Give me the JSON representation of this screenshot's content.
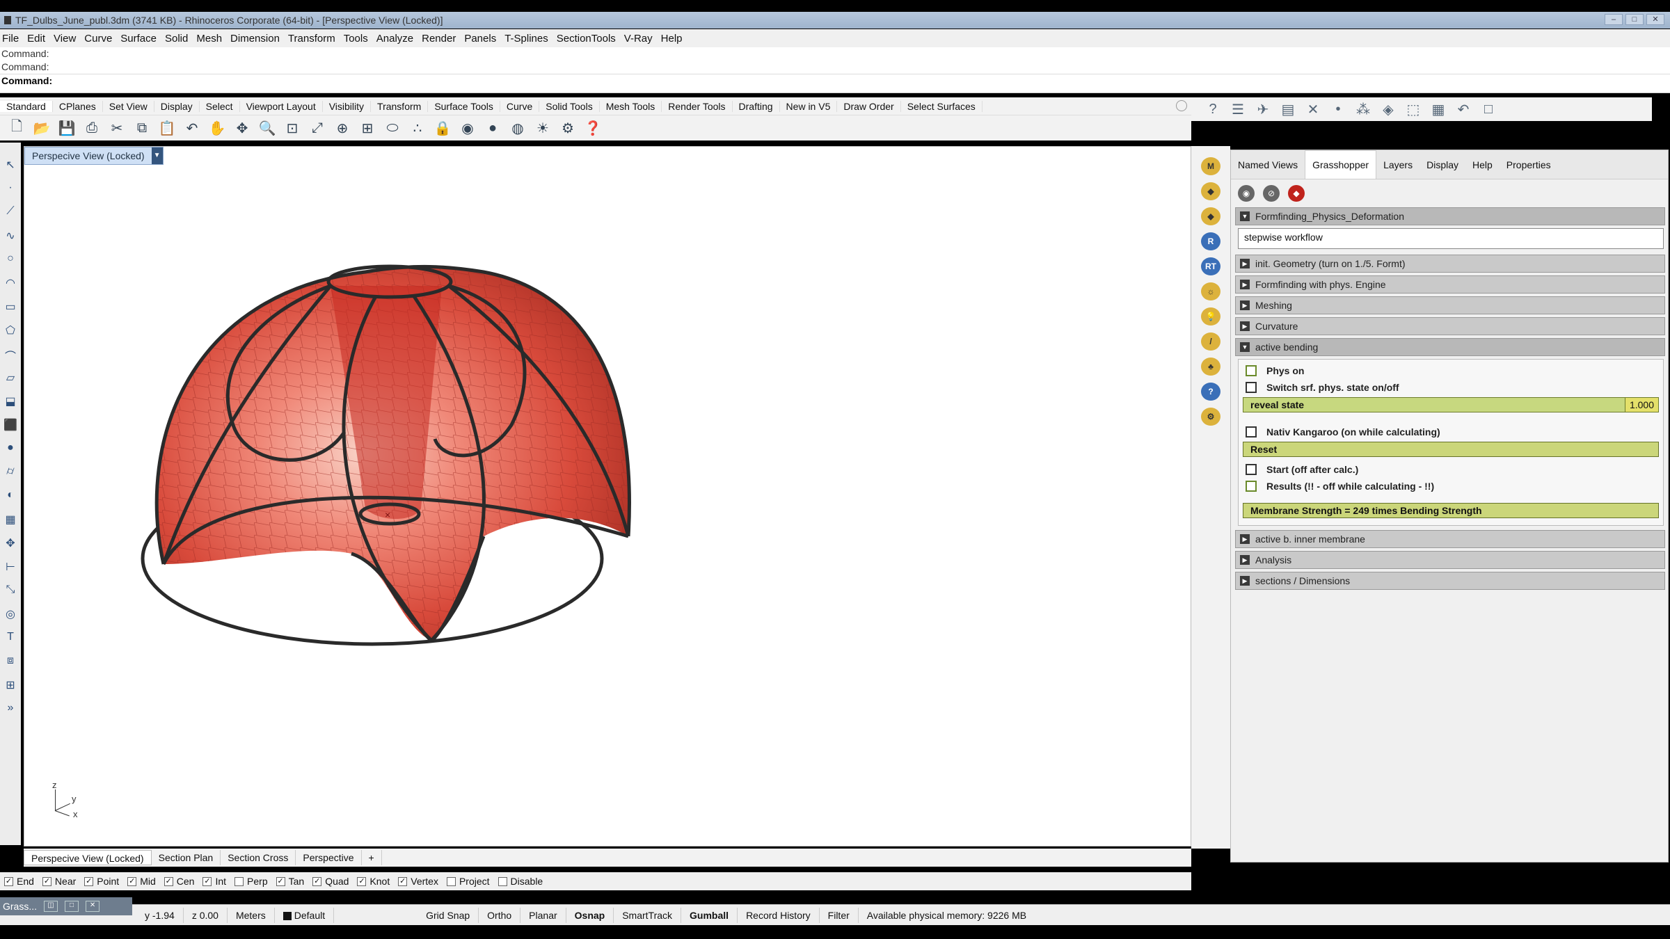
{
  "window": {
    "title": "TF_Dulbs_June_publ.3dm (3741 KB) - Rhinoceros Corporate (64-bit) - [Perspective View (Locked)]"
  },
  "menu": [
    "File",
    "Edit",
    "View",
    "Curve",
    "Surface",
    "Solid",
    "Mesh",
    "Dimension",
    "Transform",
    "Tools",
    "Analyze",
    "Render",
    "Panels",
    "T-Splines",
    "SectionTools",
    "V-Ray",
    "Help"
  ],
  "command": {
    "lines": [
      "Command:",
      "Command:"
    ],
    "active": "Command:"
  },
  "toolbar_tabs": [
    "Standard",
    "CPlanes",
    "Set View",
    "Display",
    "Select",
    "Viewport Layout",
    "Visibility",
    "Transform",
    "Surface Tools",
    "Curve",
    "Solid Tools",
    "Mesh Tools",
    "Render Tools",
    "Drafting",
    "New in V5",
    "Draw Order",
    "Select Surfaces"
  ],
  "viewport": {
    "title": "Perspecive View (Locked)",
    "axes": {
      "z": "z",
      "y": "y",
      "x": "x"
    }
  },
  "viewport_tabs": [
    "Perspecive View (Locked)",
    "Section Plan",
    "Section Cross",
    "Perspective",
    "+"
  ],
  "osnap": [
    {
      "label": "End",
      "checked": true
    },
    {
      "label": "Near",
      "checked": true
    },
    {
      "label": "Point",
      "checked": true
    },
    {
      "label": "Mid",
      "checked": true
    },
    {
      "label": "Cen",
      "checked": true
    },
    {
      "label": "Int",
      "checked": true
    },
    {
      "label": "Perp",
      "checked": false
    },
    {
      "label": "Tan",
      "checked": true
    },
    {
      "label": "Quad",
      "checked": true
    },
    {
      "label": "Knot",
      "checked": true
    },
    {
      "label": "Vertex",
      "checked": true
    },
    {
      "label": "Project",
      "checked": false
    },
    {
      "label": "Disable",
      "checked": false
    }
  ],
  "status": {
    "grass": "Grass...",
    "y": "y -1.94",
    "z": "z 0.00",
    "units": "Meters",
    "layer": "Default",
    "toggles": [
      "Grid Snap",
      "Ortho",
      "Planar",
      "Osnap",
      "SmartTrack",
      "Gumball",
      "Record History",
      "Filter"
    ],
    "bold_toggles": [
      "Osnap",
      "Gumball"
    ],
    "memory": "Available physical memory: 9226 MB"
  },
  "panel_tabs": [
    "Named Views",
    "Grasshopper",
    "Layers",
    "Display",
    "Help",
    "Properties"
  ],
  "gh": {
    "header": "Formfinding_Physics_Deformation",
    "note": "stepwise workflow",
    "groups_before": [
      "init. Geometry (turn on 1./5. Formt)",
      "Formfinding with phys. Engine",
      "Meshing",
      "Curvature"
    ],
    "open_group": "active bending",
    "phys_on": "Phys on",
    "switch": "Switch srf. phys. state on/off",
    "slider_label": "reveal state",
    "slider_value": "1.000",
    "nativ": "Nativ Kangaroo (on while calculating)",
    "reset": "Reset",
    "start": "Start (off after calc.)",
    "results": "Results (!! - off while calculating - !!)",
    "membrane": "Membrane Strength = 249 times Bending Strength",
    "groups_after": [
      "active b. inner membrane",
      "Analysis",
      "sections / Dimensions"
    ]
  },
  "colors": {
    "surface": "#e24a3b",
    "edge": "#2a2a2a",
    "accent": "#c7d87f"
  }
}
